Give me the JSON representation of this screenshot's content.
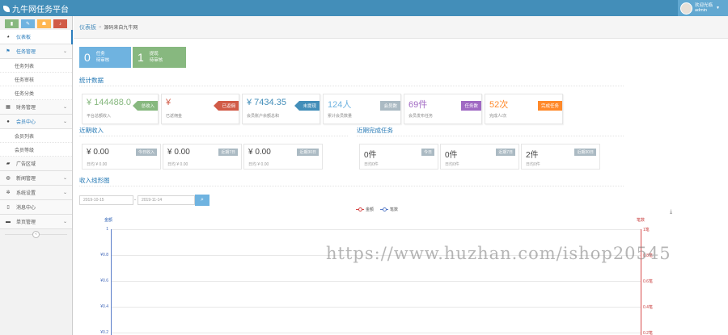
{
  "header": {
    "brand": "九牛网任务平台",
    "user_greeting": "欢迎光临",
    "user_name": "admin"
  },
  "sidebar": {
    "shortcut_colors": [
      "#87b87f",
      "#6fb3e0",
      "#ffb752",
      "#d15b47"
    ],
    "items": [
      {
        "label": "仪表板",
        "icon": "dashboard-icon"
      },
      {
        "label": "任务管理",
        "icon": "flag-icon"
      },
      {
        "label": "任务列表"
      },
      {
        "label": "任务审核"
      },
      {
        "label": "任务分类"
      },
      {
        "label": "财务管理",
        "icon": "calendar-icon"
      },
      {
        "label": "会员中心",
        "icon": "user-icon"
      },
      {
        "label": "会员列表"
      },
      {
        "label": "会员等级"
      },
      {
        "label": "广告区域",
        "icon": "picture-icon"
      },
      {
        "label": "新闻管理",
        "icon": "globe-icon"
      },
      {
        "label": "系统设置",
        "icon": "gear-icon"
      },
      {
        "label": "消息中心",
        "icon": "bookmark-icon"
      },
      {
        "label": "单页管理",
        "icon": "folder-icon"
      }
    ]
  },
  "breadcrumb": {
    "home": "仪表板",
    "current": "源码来自九牛网"
  },
  "tasks": [
    {
      "count": "0",
      "label1": "任务",
      "label2": "待审核",
      "color": "#6fb3e0"
    },
    {
      "count": "1",
      "label1": "提现",
      "label2": "待审核",
      "color": "#87b87f"
    }
  ],
  "stats_section": {
    "title": "统计数据",
    "cards": [
      {
        "value": "¥ 144488.0",
        "sub": "平台总额收入",
        "tag": "总收入",
        "color": "#87b87f"
      },
      {
        "value": "¥",
        "sub": "已返佣金",
        "tag": "已返佣",
        "color": "#d15b47"
      },
      {
        "value": "¥ 7434.35",
        "sub": "会员账户余额总和",
        "tag": "未提现",
        "color": "#438eb9"
      },
      {
        "value": "124人",
        "sub": "累计会员数量",
        "tag": "会员数",
        "color": "#abbac3"
      },
      {
        "value": "69件",
        "sub": "会员发布任务",
        "tag": "任务数",
        "color": "#a069c3"
      },
      {
        "value": "52次",
        "sub": "完成人/次",
        "tag": "完成任务",
        "color": "#ff892a"
      }
    ]
  },
  "income_section": {
    "title": "近期收入",
    "cards": [
      {
        "value": "¥ 0.00",
        "sub": "日均 ¥ 0.00",
        "tag": "今日收入"
      },
      {
        "value": "¥ 0.00",
        "sub": "日均 ¥ 0.00",
        "tag": "近期7日"
      },
      {
        "value": "¥ 0.00",
        "sub": "日均 ¥ 0.00",
        "tag": "近期30日"
      }
    ]
  },
  "tasks_section": {
    "title": "近期完成任务",
    "cards": [
      {
        "value": "0件",
        "sub": "日均0件",
        "tag": "今日"
      },
      {
        "value": "0件",
        "sub": "日均0件",
        "tag": "近期7日"
      },
      {
        "value": "2件",
        "sub": "日均0件",
        "tag": "近期30日"
      }
    ]
  },
  "chart_section": {
    "title": "收入线形图",
    "date_from": "2019-10-15",
    "date_to": "2019-11-14"
  },
  "chart_data": {
    "type": "line",
    "legend": [
      "金额",
      "笔数"
    ],
    "legend_colors": [
      "#d64b4b",
      "#5b7ec9"
    ],
    "ylabel_left": "金额",
    "ylabel_right": "笔数",
    "y_ticks_left": [
      "1",
      "¥0.8",
      "¥0.6",
      "¥0.4",
      "¥0.2"
    ],
    "y_ticks_right": [
      "1笔",
      "0.8笔",
      "0.6笔",
      "0.4笔",
      "0.2笔"
    ],
    "ylim": [
      0,
      1
    ],
    "series": []
  },
  "watermark": "https://www.huzhan.com/ishop20545"
}
